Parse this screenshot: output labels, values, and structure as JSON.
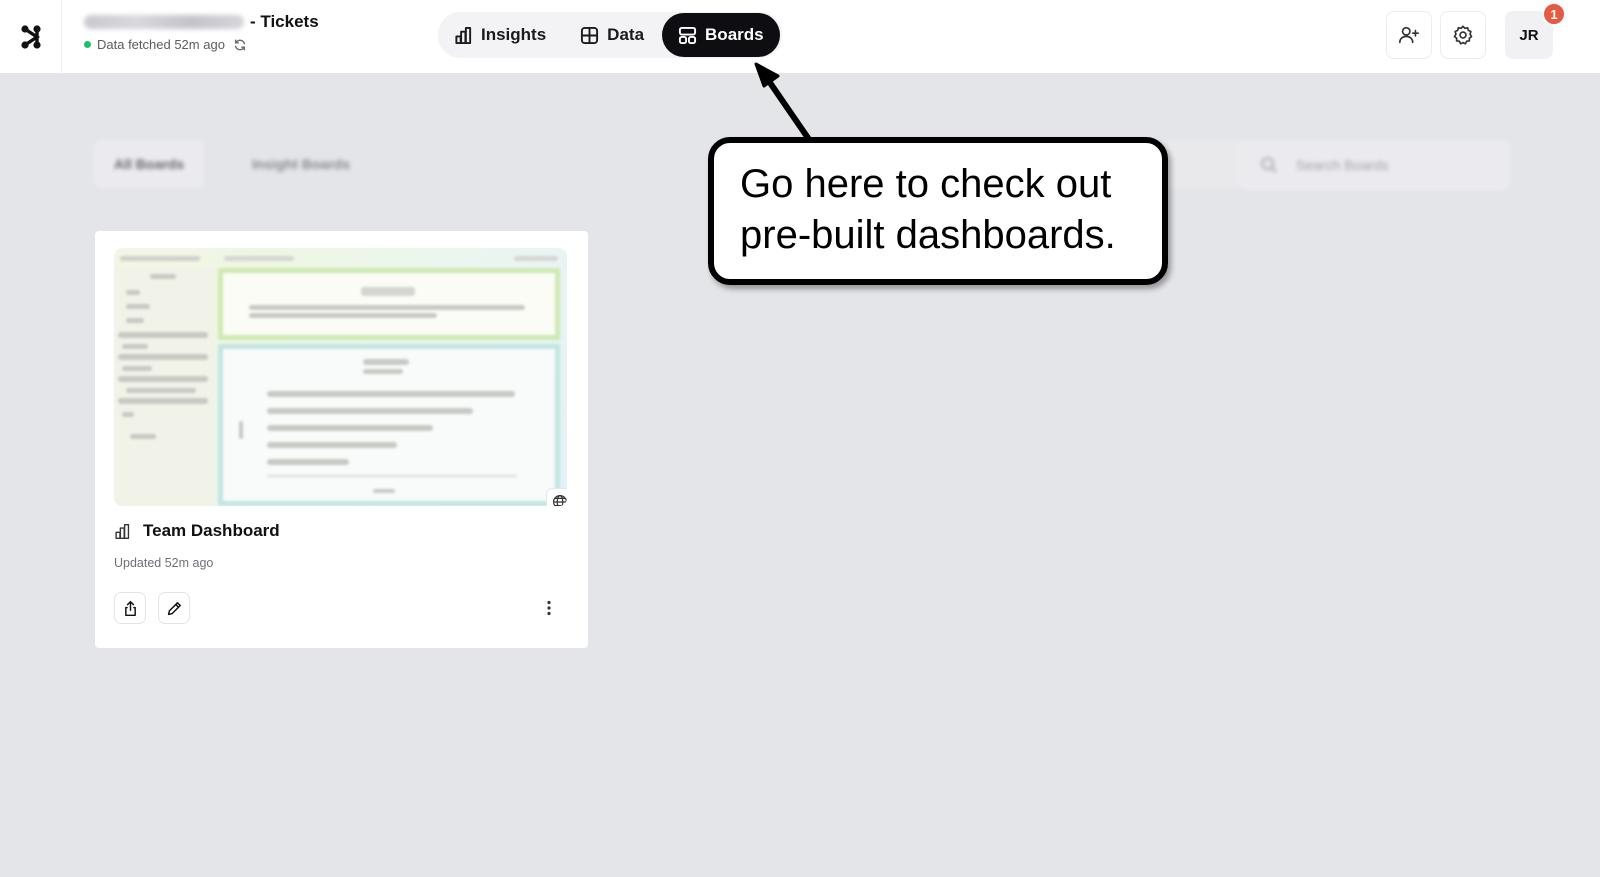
{
  "header": {
    "title_suffix": "- Tickets",
    "status_text": "Data fetched 52m ago"
  },
  "nav": {
    "items": [
      {
        "label": "Insights",
        "icon": "bar-chart-icon",
        "active": false
      },
      {
        "label": "Data",
        "icon": "table-grid-icon",
        "active": false
      },
      {
        "label": "Boards",
        "icon": "boards-layout-icon",
        "active": true
      }
    ]
  },
  "toolbar": {
    "invite_icon": "add-user-icon",
    "settings_icon": "gear-icon",
    "avatar_initials": "JR",
    "notification_count": "1"
  },
  "filters": {
    "tabs": [
      "All Boards",
      "Insight Boards"
    ],
    "search_placeholder": "Search Boards"
  },
  "board_card": {
    "title": "Team Dashboard",
    "updated": "Updated 52m ago",
    "icon": "bar-chart-icon"
  },
  "callout": {
    "line1": "Go here to check out",
    "line2": "pre-built dashboards."
  },
  "colors": {
    "accent_dark": "#0e0e12",
    "status_green": "#1fbf6a",
    "badge_red": "#e45b43",
    "page_bg": "#e4e5e9"
  }
}
